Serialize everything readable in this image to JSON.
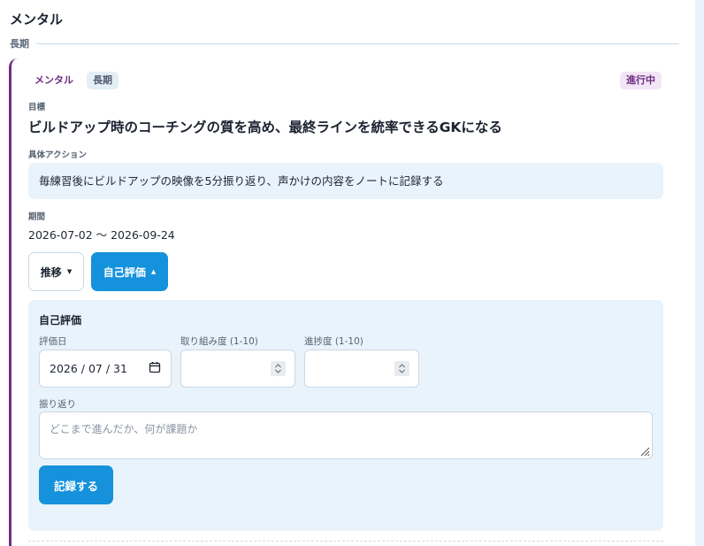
{
  "section": {
    "title": "メンタル"
  },
  "period": {
    "label": "長期"
  },
  "card": {
    "category_tag": "メンタル",
    "term_tag": "長期",
    "status_badge": "進行中",
    "goal_label": "目標",
    "goal_text": "ビルドアップ時のコーチングの質を高め、最終ラインを統率できるGKになる",
    "action_label": "具体アクション",
    "action_text": "毎練習後にビルドアップの映像を5分振り返り、声かけの内容をノートに記録する",
    "period_label": "期間",
    "date_range": "2026-07-02 〜 2026-09-24",
    "trend_button": "推移",
    "self_eval_button": "自己評価",
    "caret_down": "▼",
    "caret_up": "▲"
  },
  "self_eval": {
    "title": "自己評価",
    "date_label": "評価日",
    "date_value": "2026 / 07 / 31",
    "effort_label": "取り組み度 (1-10)",
    "effort_value": "",
    "progress_label": "進捗度 (1-10)",
    "progress_value": "",
    "reflection_label": "振り返り",
    "reflection_placeholder": "どこまで進んだか、何が課題か",
    "submit_button": "記録する"
  },
  "colors": {
    "accent": "#1592db",
    "card_border": "#6f2d84",
    "panel_bg": "#e9f3fb"
  },
  "icons": {
    "date_picker": "calendar-icon",
    "number_spinner": "spinner-icon",
    "textarea_resize": "resize-grip-icon"
  }
}
